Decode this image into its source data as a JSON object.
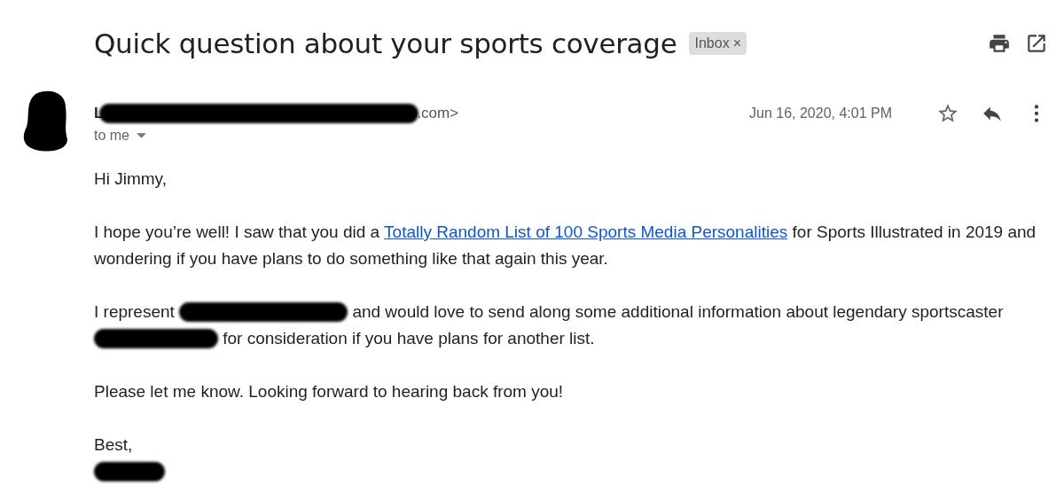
{
  "subject": "Quick question about your sports coverage",
  "labels": [
    {
      "text": "Inbox",
      "remove": "×"
    }
  ],
  "sender": {
    "segments": [
      {
        "kind": "name",
        "text": "L"
      },
      {
        "kind": "redaction"
      },
      {
        "kind": "address",
        "text": ".com>"
      }
    ]
  },
  "recipient": "to me",
  "date": "Jun 16, 2020, 4:01 PM",
  "starred": false,
  "body": [
    [
      {
        "kind": "text",
        "text": "Hi Jimmy,"
      }
    ],
    [
      {
        "kind": "text",
        "text": "I hope you’re well! I saw that you did a "
      },
      {
        "kind": "link",
        "text": "Totally Random List of 100 Sports Media Personalities"
      },
      {
        "kind": "text",
        "text": " for Sports Illustrated in 2019 and wondering if you have plans to do something like that again this year."
      }
    ],
    [
      {
        "kind": "text",
        "text": "I represent "
      },
      {
        "kind": "redaction"
      },
      {
        "kind": "text",
        "text": " and would love to send along some additional information about legendary sportscaster "
      },
      {
        "kind": "redaction"
      },
      {
        "kind": "text",
        "text": " for consideration if you have plans for another list."
      }
    ],
    [
      {
        "kind": "text",
        "text": "Please let me know. Looking forward to hearing back from you!"
      }
    ],
    [
      {
        "kind": "text",
        "text": "Best,"
      },
      {
        "kind": "newline"
      },
      {
        "kind": "redaction"
      }
    ]
  ]
}
